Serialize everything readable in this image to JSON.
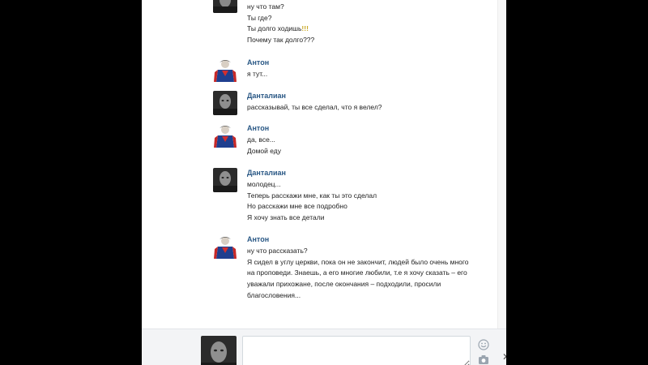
{
  "conversation": {
    "top_partial": {
      "lines": [
        "ну что там?",
        "Ты где?",
        "Ты долго ходишь",
        "Почему так долго???"
      ],
      "exclamation": "!!!"
    },
    "messages": [
      {
        "author": "Антон",
        "lines": [
          "я тут..."
        ]
      },
      {
        "author": "Данталиан",
        "lines": [
          "рассказывай, ты все сделал, что я велел?"
        ]
      },
      {
        "author": "Антон",
        "lines": [
          "да, все...",
          "Домой еду"
        ]
      },
      {
        "author": "Данталиан",
        "lines": [
          "молодец...",
          "Теперь расскажи мне, как ты это сделал",
          "Но расскажи мне все подробно",
          "Я хочу знать все детали"
        ]
      },
      {
        "author": "Антон",
        "lines": [
          "ну что рассказать?",
          "Я сидел в углу церкви, пока он не закончит, людей было очень много",
          "на проповеди. Знаешь, а его многие любили, т.е я хочу сказать – его",
          "уважали прихожане, после окончания – подходили, просили",
          "благословения..."
        ]
      }
    ]
  },
  "composer": {
    "placeholder": ""
  },
  "icons": {
    "smile": "smile-icon",
    "attach": "camera-icon",
    "close": "close-icon"
  }
}
